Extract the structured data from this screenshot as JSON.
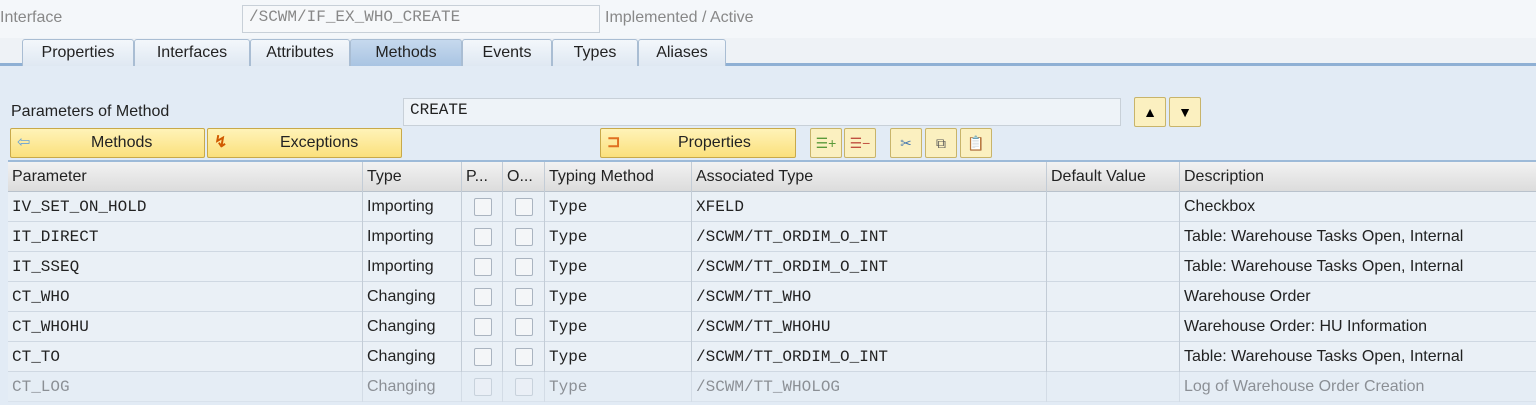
{
  "header": {
    "interface_label": "Interface",
    "interface_value": "/SCWM/IF_EX_WHO_CREATE",
    "status": "Implemented / Active"
  },
  "tabs": [
    "Properties",
    "Interfaces",
    "Attributes",
    "Methods",
    "Events",
    "Types",
    "Aliases"
  ],
  "active_tab": "Methods",
  "params_label": "Parameters of Method",
  "method_value": "CREATE",
  "buttons": {
    "methods": "Methods",
    "exceptions": "Exceptions",
    "properties": "Properties"
  },
  "columns": [
    "Parameter",
    "Type",
    "P...",
    "O...",
    "Typing Method",
    "Associated Type",
    "Default Value",
    "Description"
  ],
  "rows": [
    {
      "param": "IV_SET_ON_HOLD",
      "type": "Importing",
      "typing": "Type",
      "assoc": "XFELD",
      "default": "",
      "desc": "Checkbox"
    },
    {
      "param": "IT_DIRECT",
      "type": "Importing",
      "typing": "Type",
      "assoc": "/SCWM/TT_ORDIM_O_INT",
      "default": "",
      "desc": "Table: Warehouse Tasks Open, Internal"
    },
    {
      "param": "IT_SSEQ",
      "type": "Importing",
      "typing": "Type",
      "assoc": "/SCWM/TT_ORDIM_O_INT",
      "default": "",
      "desc": "Table: Warehouse Tasks Open, Internal"
    },
    {
      "param": "CT_WHO",
      "type": "Changing",
      "typing": "Type",
      "assoc": "/SCWM/TT_WHO",
      "default": "",
      "desc": "Warehouse Order"
    },
    {
      "param": "CT_WHOHU",
      "type": "Changing",
      "typing": "Type",
      "assoc": "/SCWM/TT_WHOHU",
      "default": "",
      "desc": "Warehouse Order: HU Information"
    },
    {
      "param": "CT_TO",
      "type": "Changing",
      "typing": "Type",
      "assoc": "/SCWM/TT_ORDIM_O_INT",
      "default": "",
      "desc": "Table: Warehouse Tasks Open, Internal"
    },
    {
      "param": "CT_LOG",
      "type": "Changing",
      "typing": "Type",
      "assoc": "/SCWM/TT_WHOLOG",
      "default": "",
      "desc": "Log of Warehouse Order Creation"
    }
  ]
}
